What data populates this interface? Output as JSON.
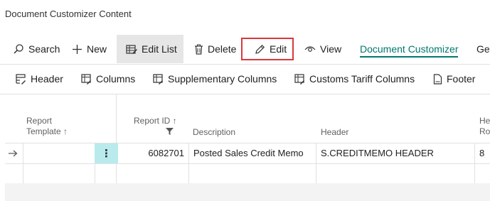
{
  "page_title": "Document Customizer Content",
  "actions": {
    "search": "Search",
    "new": "New",
    "edit_list": "Edit List",
    "delete": "Delete",
    "edit": "Edit",
    "view": "View",
    "document_customizer": "Document Customizer",
    "overflow": "Ge"
  },
  "nav": {
    "header": "Header",
    "columns": "Columns",
    "supplementary_columns": "Supplementary Columns",
    "customs_tariff_columns": "Customs Tariff Columns",
    "footer": "Footer"
  },
  "table": {
    "headers": {
      "report_template_line1": "Report",
      "report_template_line2": "Template ↑",
      "report_id": "Report ID ↑",
      "description": "Description",
      "header": "Header",
      "header_rows_line1": "He",
      "header_rows_line2": "Ro"
    },
    "rows": [
      {
        "report_template": "",
        "report_id": "6082701",
        "description": "Posted Sales Credit Memo",
        "header": "S.CREDITMEMO HEADER",
        "header_rows": "8"
      }
    ]
  },
  "colors": {
    "accent": "#00786e",
    "highlight_border": "#d9373c",
    "selected_cell": "#b9ebed"
  }
}
